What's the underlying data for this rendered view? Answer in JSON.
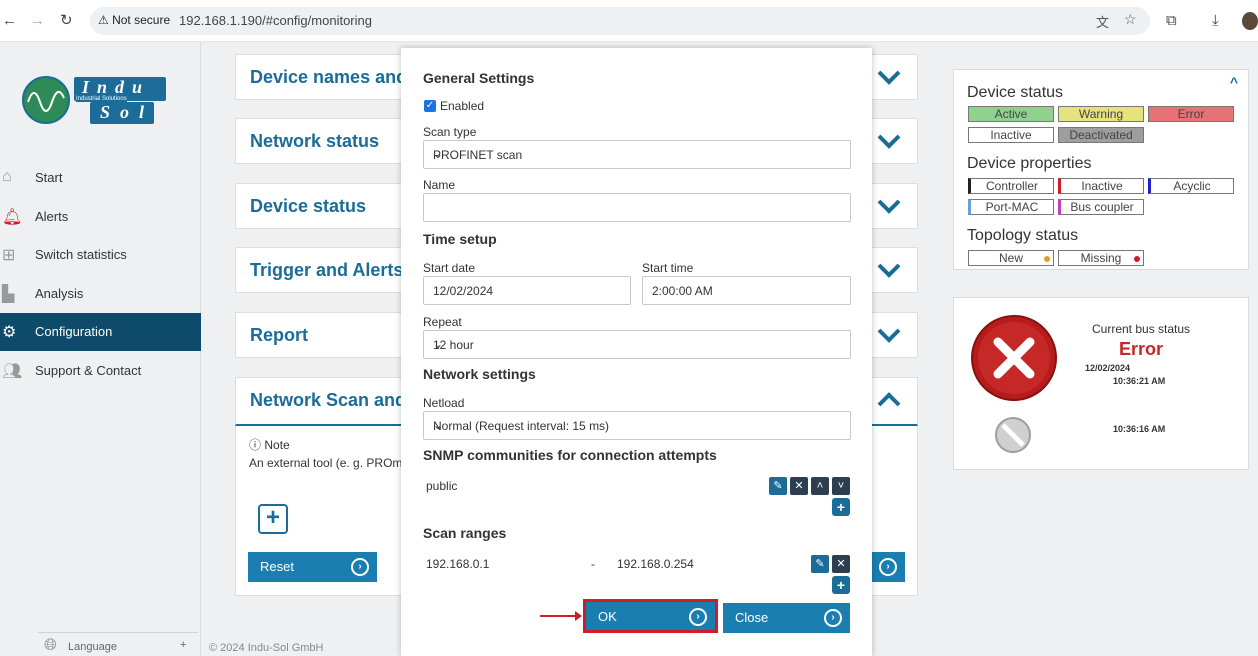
{
  "browser": {
    "security_label": "Not secure",
    "url": "192.168.1.190/#config/monitoring"
  },
  "sidebar": {
    "logo_text_top": "Indu",
    "logo_text_bottom": "Sol",
    "logo_tagline": "Industrial Solutions",
    "items": [
      {
        "label": "Start",
        "icon": "home-icon"
      },
      {
        "label": "Alerts",
        "icon": "bell-icon"
      },
      {
        "label": "Switch statistics",
        "icon": "network-icon"
      },
      {
        "label": "Analysis",
        "icon": "chart-icon"
      },
      {
        "label": "Configuration",
        "icon": "gears-icon"
      },
      {
        "label": "Support & Contact",
        "icon": "users-icon"
      }
    ],
    "language_label": "Language",
    "language_plus": "+"
  },
  "footer": {
    "copyright": "© 2024 Indu-Sol GmbH"
  },
  "panels": [
    {
      "title": "Device names and"
    },
    {
      "title": "Network status"
    },
    {
      "title": "Device status"
    },
    {
      "title": "Trigger and Alerts"
    },
    {
      "title": "Report"
    },
    {
      "title": "Network Scan and"
    }
  ],
  "scan_panel": {
    "note_label": "Note",
    "note_text": "An external tool (e. g. PROm",
    "reset_label": "Reset"
  },
  "device_status_card": {
    "title": "Device status",
    "status": [
      "Active",
      "Warning",
      "Error",
      "Inactive",
      "Deactivated"
    ],
    "properties_title": "Device properties",
    "properties": [
      "Controller",
      "Inactive",
      "Acyclic",
      "Port-MAC",
      "Bus coupler"
    ],
    "topology_title": "Topology status",
    "topology": [
      "New",
      "Missing"
    ]
  },
  "bus_card": {
    "title": "Current bus status",
    "status": "Error",
    "date": "12/02/2024",
    "time1": "10:36:21 AM",
    "time2": "10:36:16 AM"
  },
  "modal": {
    "general_title": "General Settings",
    "enabled_label": "Enabled",
    "scan_type_label": "Scan type",
    "scan_type_value": "PROFINET scan",
    "name_label": "Name",
    "name_value": "",
    "time_title": "Time setup",
    "start_date_label": "Start date",
    "start_date_value": "12/02/2024",
    "start_time_label": "Start time",
    "start_time_value": "2:00:00 AM",
    "repeat_label": "Repeat",
    "repeat_value": "12 hour",
    "network_title": "Network settings",
    "netload_label": "Netload",
    "netload_value": "Normal (Request interval: 15 ms)",
    "snmp_title": "SNMP communities for connection attempts",
    "snmp_community": "public",
    "scan_ranges_title": "Scan ranges",
    "range_start": "192.168.0.1",
    "range_sep": "-",
    "range_end": "192.168.0.254",
    "ok_label": "OK",
    "close_label": "Close"
  },
  "colors": {
    "accent": "#1b6c98",
    "nav_active": "#0e4a6a",
    "highlight": "#d01c25",
    "active": "#8fd18f",
    "warning": "#e6e37e",
    "error": "#e57373",
    "deactivated": "#9e9e9e"
  }
}
